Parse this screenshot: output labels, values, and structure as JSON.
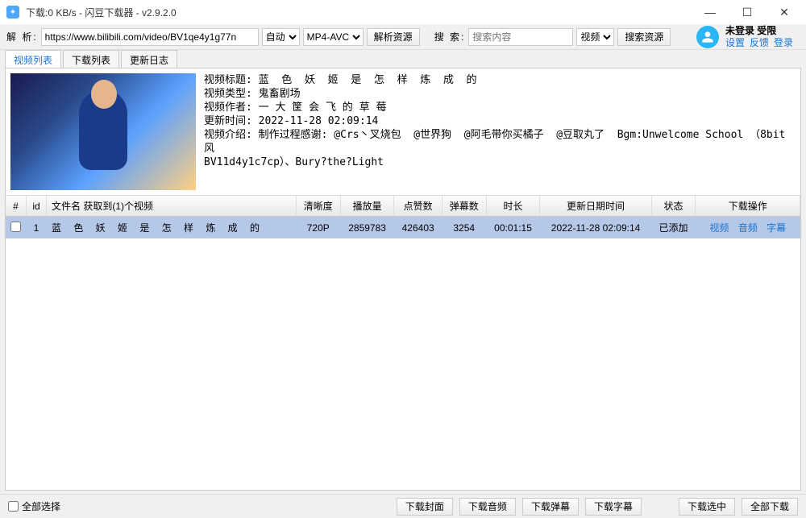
{
  "window": {
    "title": "下载:0 KB/s - 闪豆下载器 - v2.9.2.0"
  },
  "toolbar": {
    "parse_label": "解 析:",
    "url_value": "https://www.bilibili.com/video/BV1qe4y1g77n",
    "auto_option": "自动",
    "format_option": "MP4-AVC",
    "parse_btn": "解析资源",
    "search_label": "搜 索:",
    "search_placeholder": "搜索内容",
    "search_type": "视频",
    "search_btn": "搜索资源"
  },
  "user": {
    "status": "未登录  受限",
    "link_settings": "设置",
    "link_feedback": "反馈",
    "link_login": "登录"
  },
  "tabs": {
    "t1": "视频列表",
    "t2": "下载列表",
    "t3": "更新日志"
  },
  "meta": {
    "title_label": "视频标题:",
    "title_value": "蓝  色  妖  姬  是  怎  样  炼  成  的",
    "type_label": "视频类型:",
    "type_value": "鬼畜剧场",
    "author_label": "视频作者:",
    "author_value": "一 大 筐 会 飞 的 草 莓",
    "update_label": "更新时间:",
    "update_value": "2022-11-28 02:09:14",
    "desc_label": "视频介绍:",
    "desc_value": "制作过程感谢: @Crs丶叉烧包  @世界狗  @阿毛带你买橘子  @豆取丸了  Bgm:Unwelcome School （8bit风\nBV11d4y1c7cp）、Bury?the?Light"
  },
  "table": {
    "headers": {
      "chk": "#",
      "id": "id",
      "filename": "文件名       获取到(1)个视频",
      "quality": "清晰度",
      "plays": "播放量",
      "likes": "点赞数",
      "danmu": "弹幕数",
      "duration": "时长",
      "updated": "更新日期时间",
      "status": "状态",
      "ops": "下载操作"
    },
    "rows": [
      {
        "id": "1",
        "filename": "蓝 色 妖 姬 是 怎 样 炼 成 的",
        "quality": "720P",
        "plays": "2859783",
        "likes": "426403",
        "danmu": "3254",
        "duration": "00:01:15",
        "updated": "2022-11-28 02:09:14",
        "status": "已添加",
        "op_video": "视频",
        "op_audio": "音频",
        "op_sub": "字幕"
      }
    ]
  },
  "footer": {
    "select_all": "全部选择",
    "dl_cover": "下载封面",
    "dl_audio": "下载音频",
    "dl_danmu": "下载弹幕",
    "dl_sub": "下载字幕",
    "dl_selected": "下载选中",
    "dl_all": "全部下载"
  }
}
